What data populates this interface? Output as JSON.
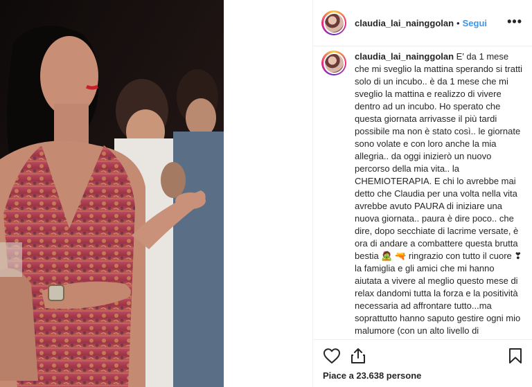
{
  "post": {
    "username": "claudia_lai_nainggolan",
    "follow_label": "Segui",
    "dot": "•",
    "more_label": "•••",
    "caption_username": "claudia_lai_nainggolan",
    "caption_text": "E' da 1 mese che mi sveglio la mattina sperando si tratti solo di un incubo.. è da 1 mese che mi sveglio la mattina e realizzo di vivere dentro ad un incubo. Ho sperato che questa giornata arrivasse il più tardi possibile ma non è stato così.. le giornate sono volate e con loro anche la mia allegria.. da oggi inizierò un nuovo percorso della mia vita.. la CHEMIOTERAPIA. E chi lo avrebbe mai detto che Claudia per una volta nella vita avrebbe avuto PAURA di iniziare una nuova giornata.. paura è dire poco.. che dire, dopo secchiate di lacrime versate, è ora di andare a combattere questa brutta bestia 🧟 🔫 ringrazio con tutto il cuore ❣ la famiglia e gli amici che mi hanno aiutata a vivere al meglio questo mese di relax dandomi tutta la forza e la positività necessaria ad affrontare tutto...ma soprattutto hanno saputo gestire ogni mio malumore (con un alto livello di",
    "likes_text": "Piace a 23.638 persone"
  },
  "icons": {
    "like": "heart-icon",
    "share": "share-icon",
    "save": "bookmark-icon",
    "more": "more-options-icon"
  },
  "colors": {
    "follow": "#3897f0",
    "text": "#262626",
    "border": "#efefef"
  }
}
